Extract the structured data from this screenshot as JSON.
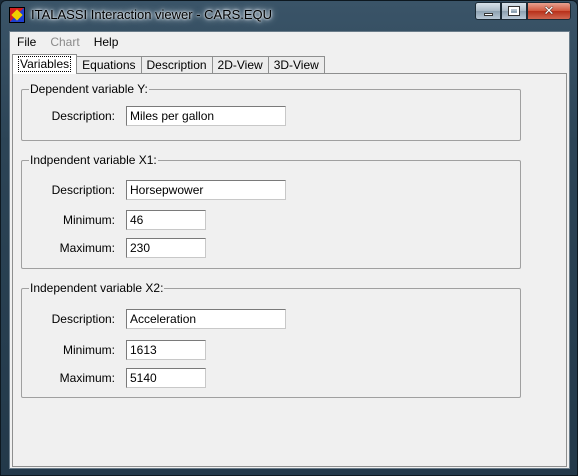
{
  "window": {
    "title": "ITALASSI Interaction viewer - CARS.EQU",
    "min_glyph": "",
    "max_glyph": "",
    "close_glyph": "✕"
  },
  "menu": [
    {
      "label": "File",
      "enabled": true
    },
    {
      "label": "Chart",
      "enabled": false
    },
    {
      "label": "Help",
      "enabled": true
    }
  ],
  "tabs": [
    "Variables",
    "Equations",
    "Description",
    "2D-View",
    "3D-View"
  ],
  "active_tab": "Variables",
  "dependent": {
    "legend": "Dependent variable Y:",
    "description_label": "Description:",
    "description_value": "Miles per gallon"
  },
  "independent1": {
    "legend": "Indpendent variable X1:",
    "description_label": "Description:",
    "description_value": "Horsepwower",
    "minimum_label": "Minimum:",
    "minimum_value": "46",
    "maximum_label": "Maximum:",
    "maximum_value": "230"
  },
  "independent2": {
    "legend": "Independent variable X2:",
    "description_label": "Description:",
    "description_value": "Acceleration",
    "minimum_label": "Minimum:",
    "minimum_value": "1613",
    "maximum_label": "Maximum:",
    "maximum_value": "5140"
  },
  "colors": {
    "window_frame": "#2c4456",
    "client_bg": "#f0f0f0",
    "close_button": "#c8402a"
  }
}
